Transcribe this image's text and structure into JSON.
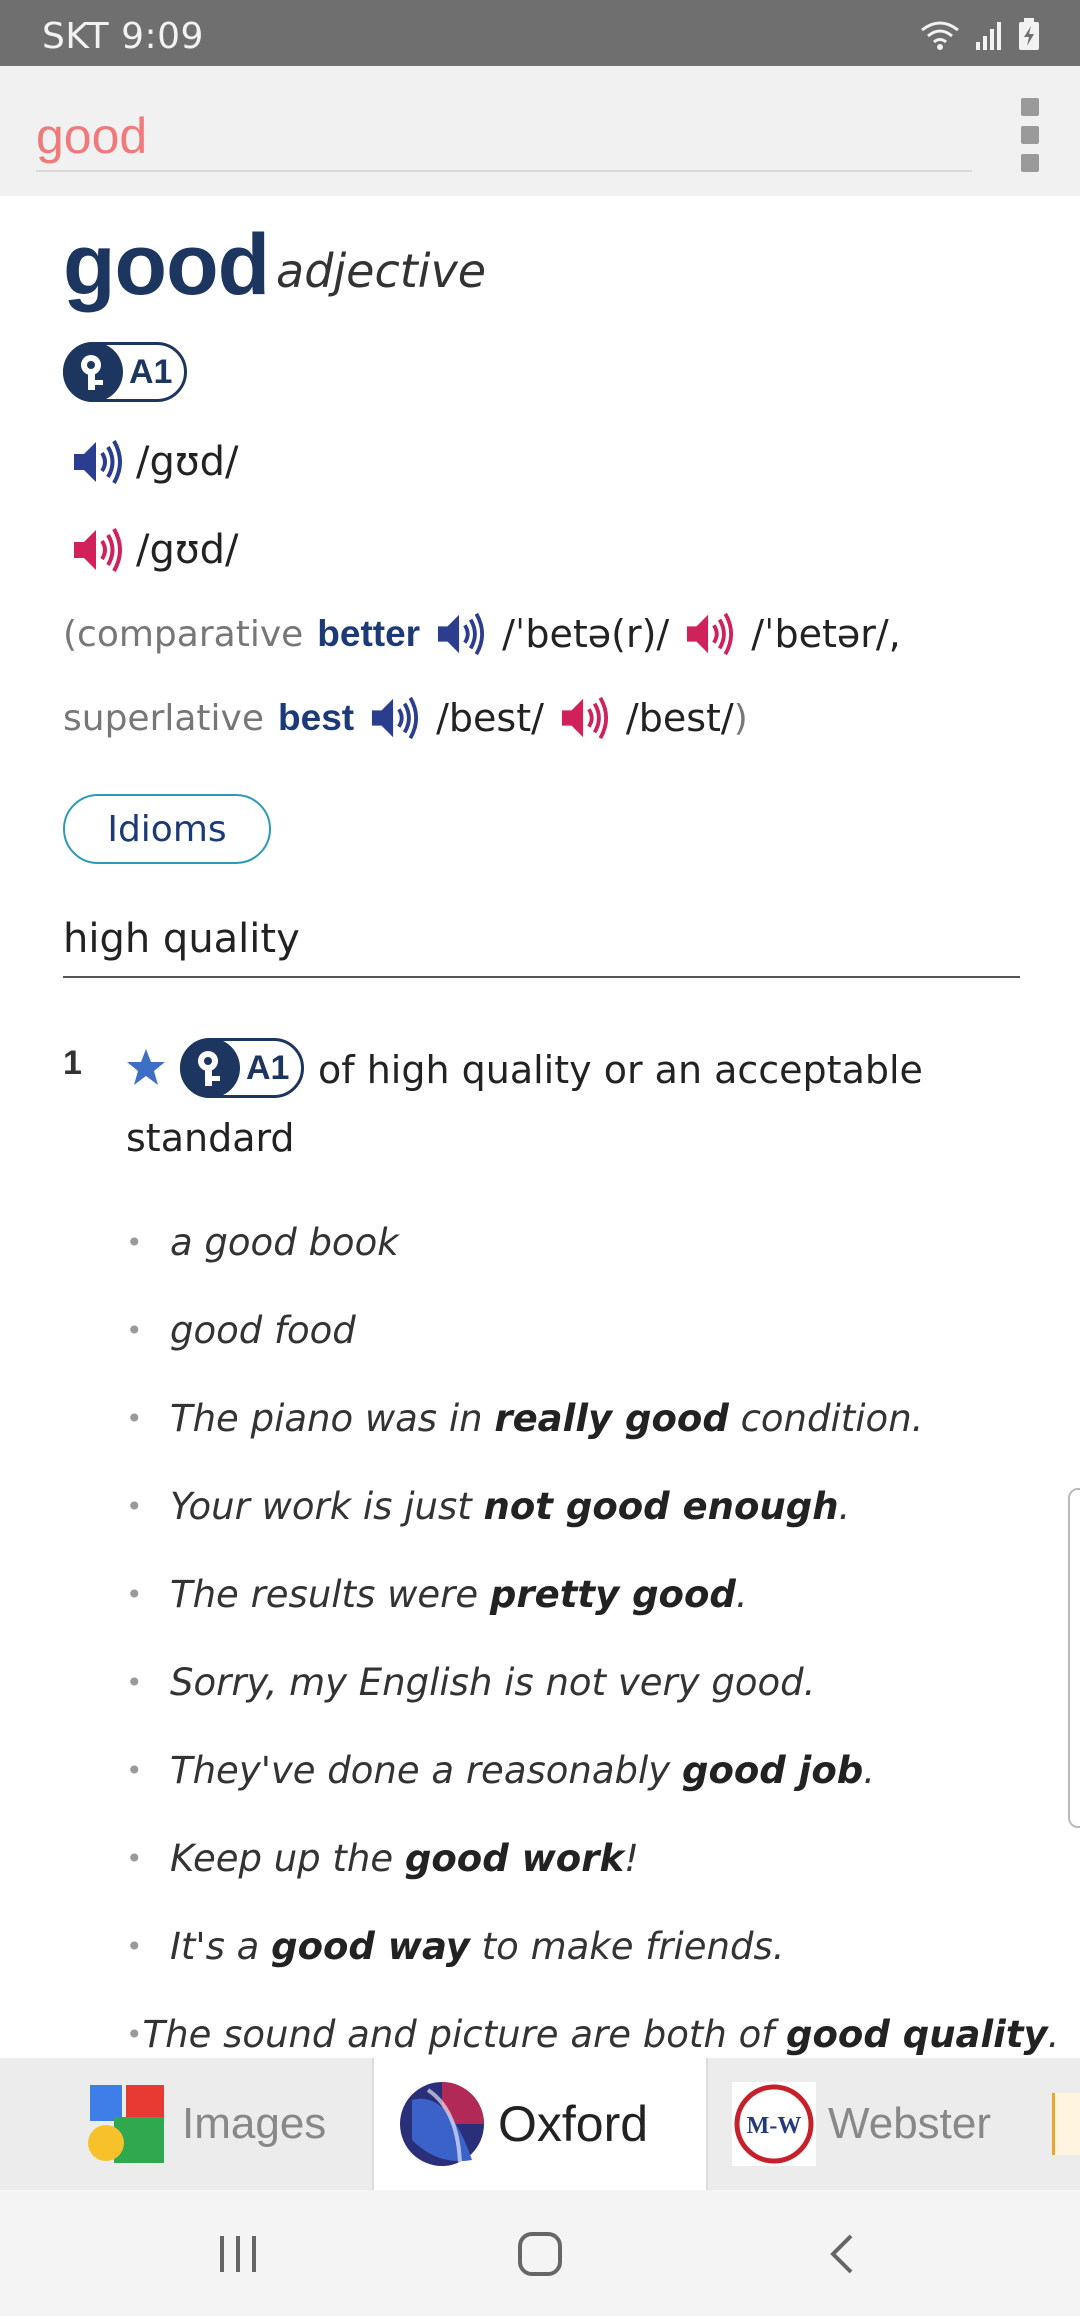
{
  "status_bar": {
    "carrier_time": "SKT 9:09"
  },
  "search": {
    "query": "good"
  },
  "entry": {
    "headword": "good",
    "part_of_speech": "adjective",
    "level": "A1",
    "pron_uk": "/gʊd/",
    "pron_us": "/gʊd/",
    "forms": {
      "open_paren": "(comparative",
      "comparative": "better",
      "comparative_uk": "/ˈbetə(r)/",
      "comparative_us": "/ˈbetər/,",
      "superlative_label": "superlative",
      "superlative": "best",
      "superlative_uk": "/best/",
      "superlative_us": "/best/",
      "close_paren": ")"
    },
    "idioms_label": "Idioms",
    "section_heading": "high quality",
    "sense": {
      "number": "1",
      "level": "A1",
      "definition": "of high quality or an acceptable standard"
    },
    "examples": [
      {
        "pre": "a good book",
        "bold": "",
        "post": ""
      },
      {
        "pre": "good food",
        "bold": "",
        "post": ""
      },
      {
        "pre": "The piano was in ",
        "bold": "really good",
        "post": " condition."
      },
      {
        "pre": "Your work is just ",
        "bold": "not good enough",
        "post": "."
      },
      {
        "pre": "The results were ",
        "bold": "pretty good",
        "post": "."
      },
      {
        "pre": "Sorry, my English is not very good.",
        "bold": "",
        "post": ""
      },
      {
        "pre": "They've done a reasonably ",
        "bold": "good job",
        "post": "."
      },
      {
        "pre": "Keep up the ",
        "bold": "good work",
        "post": "!"
      },
      {
        "pre": "It's a ",
        "bold": "good way",
        "post": " to make friends."
      },
      {
        "pre": "The sound and picture are both of ",
        "bold": "good quality",
        "post": "."
      }
    ]
  },
  "tabs": {
    "images": "Images",
    "oxford": "Oxford",
    "webster": "Webster",
    "webster_logo_text": "M-W"
  },
  "colors": {
    "navy": "#1c3660",
    "uk_speaker": "#2b3d8f",
    "us_speaker": "#d0215a",
    "search_text": "#f07a7a",
    "idioms_border": "#2a9ab8"
  },
  "icons": [
    "wifi-icon",
    "signal-icon",
    "battery-charging-icon",
    "overflow-menu-icon",
    "key-icon",
    "speaker-uk-icon",
    "speaker-us-icon",
    "star-icon",
    "recent-apps-icon",
    "home-icon",
    "back-icon"
  ]
}
